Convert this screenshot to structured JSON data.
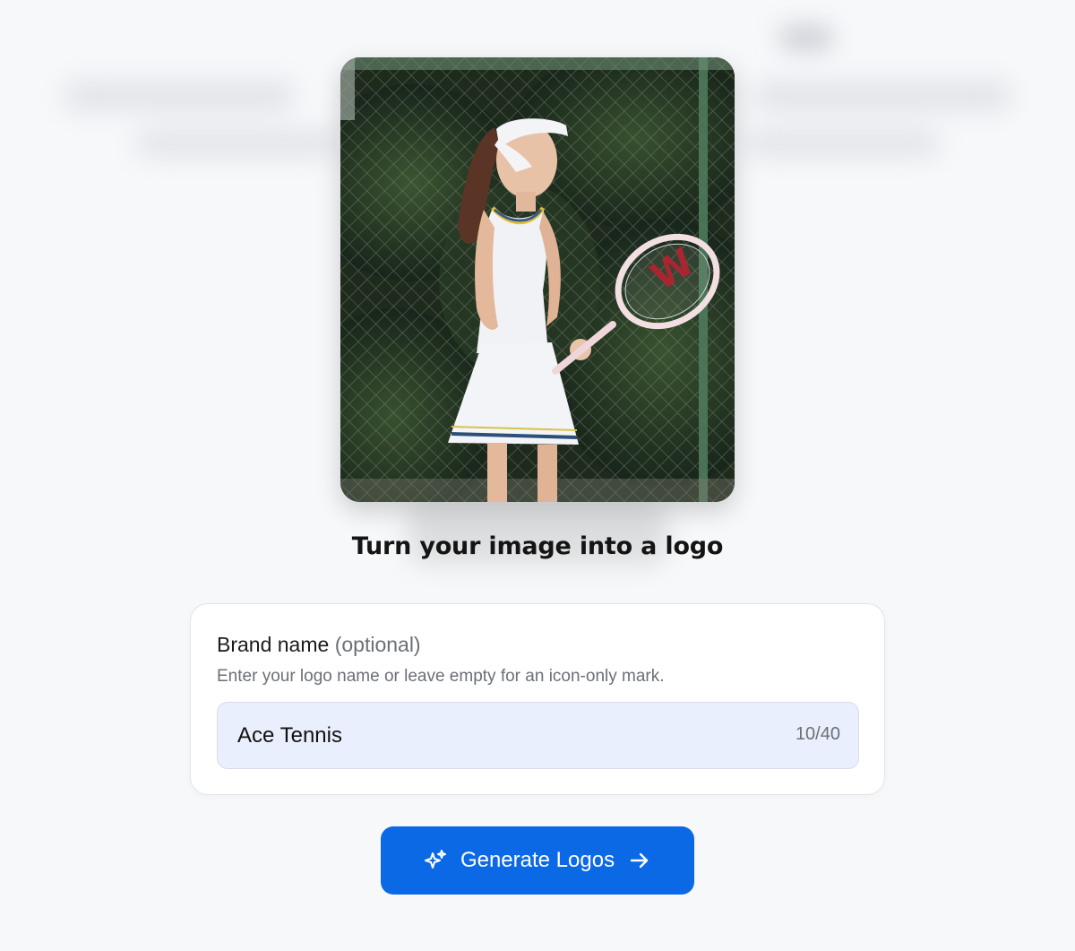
{
  "headline": "Turn your image into a logo",
  "image": {
    "alt": "Woman in white tennis dress holding a racket",
    "racket_logo": "W"
  },
  "form": {
    "label": "Brand name",
    "label_optional": "(optional)",
    "help_text": "Enter your logo name or leave empty for an icon-only mark.",
    "input_value": "Ace Tennis",
    "counter": "10/40"
  },
  "button": {
    "label": "Generate Logos",
    "left_icon": "sparkles-icon",
    "right_icon": "arrow-right-icon",
    "color": "#0b69e6"
  }
}
